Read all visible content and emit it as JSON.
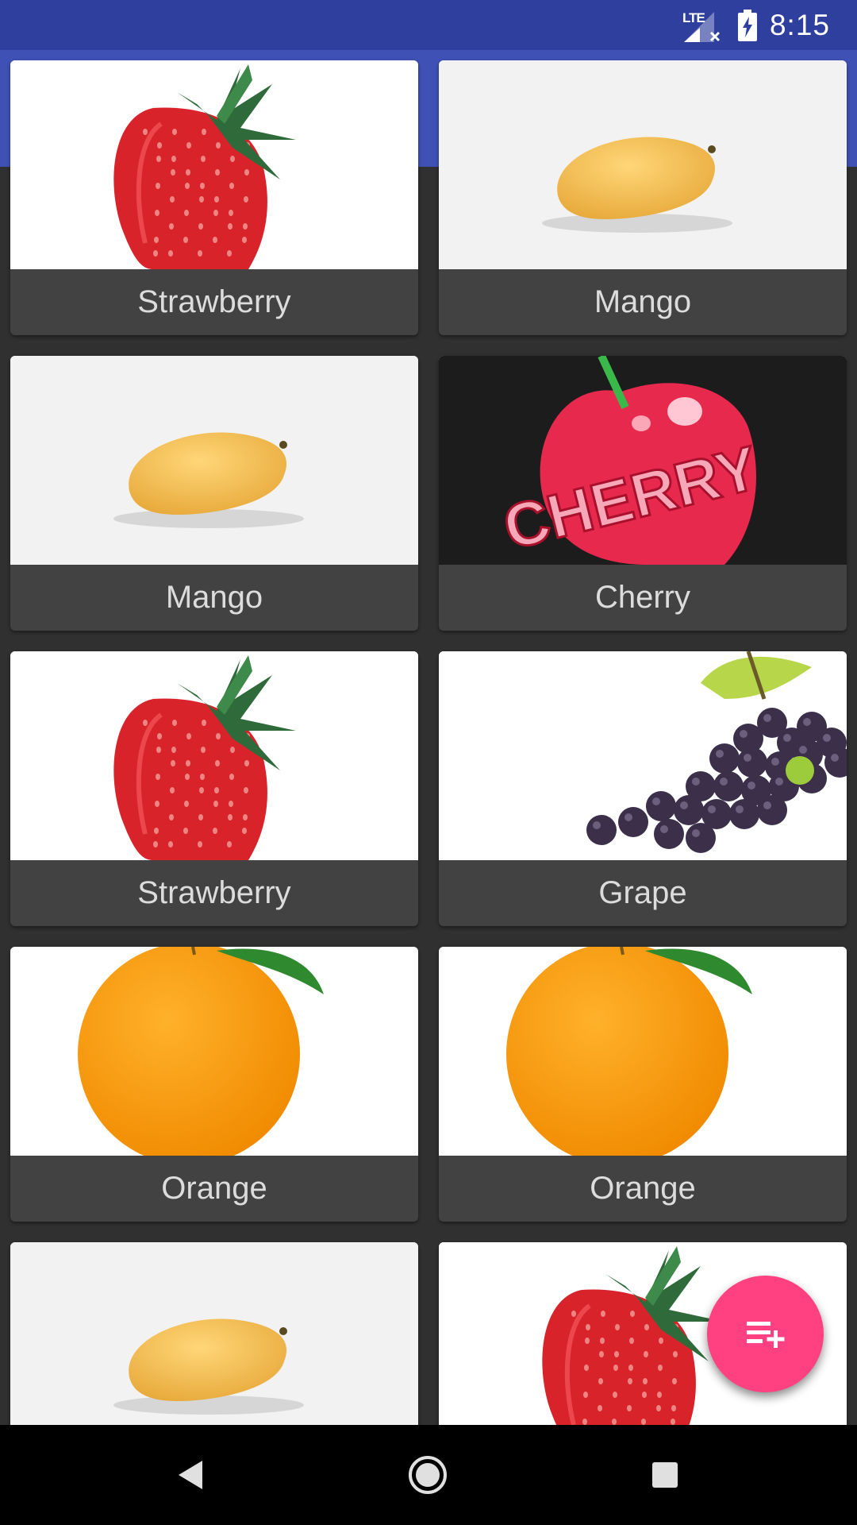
{
  "status_bar": {
    "network": "LTE",
    "time": "8:15"
  },
  "fruits": [
    {
      "name": "Strawberry",
      "image": "strawberry"
    },
    {
      "name": "Mango",
      "image": "mango"
    },
    {
      "name": "Mango",
      "image": "mango"
    },
    {
      "name": "Cherry",
      "image": "cherry",
      "image_text": "CHERRY"
    },
    {
      "name": "Strawberry",
      "image": "strawberry"
    },
    {
      "name": "Grape",
      "image": "grape"
    },
    {
      "name": "Orange",
      "image": "orange"
    },
    {
      "name": "Orange",
      "image": "orange"
    },
    {
      "name": "",
      "image": "mango"
    },
    {
      "name": "",
      "image": "strawberry"
    }
  ],
  "fab": {
    "icon": "playlist-add-icon"
  },
  "nav": {
    "back": "back-icon",
    "home": "home-icon",
    "recents": "recents-icon"
  },
  "colors": {
    "status_bar": "#2f3f9e",
    "app_bar": "#3f51b5",
    "card": "#424242",
    "fab": "#ff4081"
  }
}
